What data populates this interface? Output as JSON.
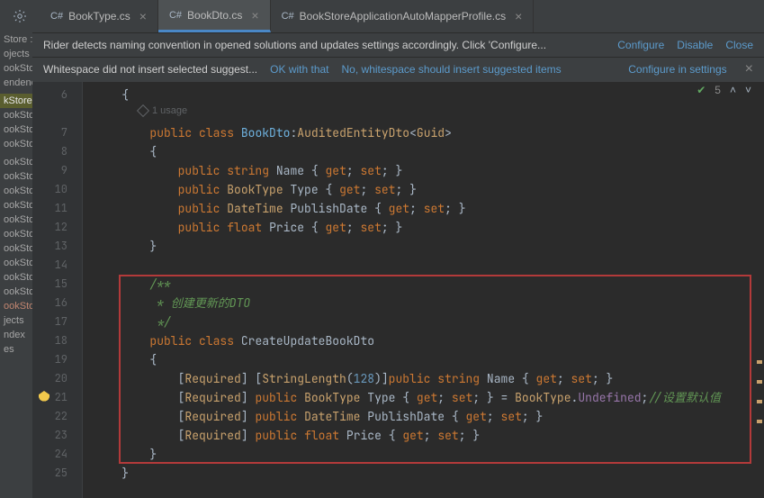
{
  "tabs": [
    {
      "label": "BookType.cs",
      "active": false
    },
    {
      "label": "BookDto.cs",
      "active": true
    },
    {
      "label": "BookStoreApplicationAutoMapperProfile.cs",
      "active": false
    }
  ],
  "banner1": {
    "msg": "Rider detects naming convention in opened solutions and updates settings accordingly. Click 'Configure...",
    "actions": {
      "configure": "Configure",
      "disable": "Disable",
      "close": "Close"
    }
  },
  "banner2": {
    "msg": "Whitespace did not insert selected suggest...",
    "actions": {
      "ok": "OK with that",
      "no": "No, whitespace should insert suggested items",
      "cfg": "Configure in settings"
    }
  },
  "leftstrip": {
    "rows": [
      "Store  : T",
      "ojects",
      "ookSto",
      "endenc",
      "",
      "kStore",
      "ookStore",
      "ookStore",
      "ookStore",
      "",
      "ookSto",
      "ookSto",
      "ookSto",
      "ookSto",
      "ookSto",
      "ookSto",
      "ookSto",
      "ookSto",
      "ookSto",
      "ookSto",
      "ookSto",
      "jects",
      "ndex",
      "es"
    ],
    "highlightIndex": 5,
    "errIndex": 20
  },
  "status": {
    "count": "5"
  },
  "code": {
    "usage": "1 usage",
    "lines": {
      "6": "    {",
      "7": {
        "t": "        ",
        "segs": [
          {
            "c": "kw",
            "t": "public"
          },
          {
            "c": "punc",
            "t": " "
          },
          {
            "c": "kw",
            "t": "class"
          },
          {
            "c": "punc",
            "t": " "
          },
          {
            "c": "ident",
            "t": "BookDto"
          },
          {
            "c": "punc",
            "t": ":"
          },
          {
            "c": "type",
            "t": "AuditedEntityDto"
          },
          {
            "c": "punc",
            "t": "<"
          },
          {
            "c": "type",
            "t": "Guid"
          },
          {
            "c": "punc",
            "t": ">"
          }
        ]
      },
      "8": "        {",
      "9": {
        "t": "            ",
        "segs": [
          {
            "c": "kw",
            "t": "public"
          },
          {
            "c": "punc",
            "t": " "
          },
          {
            "c": "kw",
            "t": "string"
          },
          {
            "c": "punc",
            "t": " "
          },
          {
            "c": "method",
            "t": "Name"
          },
          {
            "c": "punc",
            "t": " { "
          },
          {
            "c": "kw",
            "t": "get"
          },
          {
            "c": "punc",
            "t": "; "
          },
          {
            "c": "kw",
            "t": "set"
          },
          {
            "c": "punc",
            "t": "; }"
          }
        ]
      },
      "10": {
        "t": "            ",
        "segs": [
          {
            "c": "kw",
            "t": "public"
          },
          {
            "c": "punc",
            "t": " "
          },
          {
            "c": "type",
            "t": "BookType"
          },
          {
            "c": "punc",
            "t": " "
          },
          {
            "c": "method",
            "t": "Type"
          },
          {
            "c": "punc",
            "t": " { "
          },
          {
            "c": "kw",
            "t": "get"
          },
          {
            "c": "punc",
            "t": "; "
          },
          {
            "c": "kw",
            "t": "set"
          },
          {
            "c": "punc",
            "t": "; }"
          }
        ]
      },
      "11": {
        "t": "            ",
        "segs": [
          {
            "c": "kw",
            "t": "public"
          },
          {
            "c": "punc",
            "t": " "
          },
          {
            "c": "type",
            "t": "DateTime"
          },
          {
            "c": "punc",
            "t": " "
          },
          {
            "c": "method",
            "t": "PublishDate"
          },
          {
            "c": "punc",
            "t": " { "
          },
          {
            "c": "kw",
            "t": "get"
          },
          {
            "c": "punc",
            "t": "; "
          },
          {
            "c": "kw",
            "t": "set"
          },
          {
            "c": "punc",
            "t": "; }"
          }
        ]
      },
      "12": {
        "t": "            ",
        "segs": [
          {
            "c": "kw",
            "t": "public"
          },
          {
            "c": "punc",
            "t": " "
          },
          {
            "c": "kw",
            "t": "float"
          },
          {
            "c": "punc",
            "t": " "
          },
          {
            "c": "method",
            "t": "Price"
          },
          {
            "c": "punc",
            "t": " { "
          },
          {
            "c": "kw",
            "t": "get"
          },
          {
            "c": "punc",
            "t": "; "
          },
          {
            "c": "kw",
            "t": "set"
          },
          {
            "c": "punc",
            "t": "; }"
          }
        ]
      },
      "13": "        }",
      "14": "",
      "15": {
        "t": "        ",
        "segs": [
          {
            "c": "comment",
            "t": "/**"
          }
        ]
      },
      "16": {
        "t": "        ",
        "segs": [
          {
            "c": "comment",
            "t": " * 创建更新的DTO"
          }
        ]
      },
      "17": {
        "t": "        ",
        "segs": [
          {
            "c": "comment",
            "t": " */"
          }
        ]
      },
      "18": {
        "t": "        ",
        "segs": [
          {
            "c": "kw",
            "t": "public"
          },
          {
            "c": "punc",
            "t": " "
          },
          {
            "c": "kw",
            "t": "class"
          },
          {
            "c": "punc",
            "t": " "
          },
          {
            "c": "method",
            "t": "CreateUpdateBookDto"
          }
        ]
      },
      "19": "        {",
      "20": {
        "t": "            ",
        "segs": [
          {
            "c": "punc",
            "t": "["
          },
          {
            "c": "annot",
            "t": "Required"
          },
          {
            "c": "punc",
            "t": "] ["
          },
          {
            "c": "annot",
            "t": "StringLength"
          },
          {
            "c": "punc",
            "t": "("
          },
          {
            "c": "num",
            "t": "128"
          },
          {
            "c": "punc",
            "t": ")]"
          },
          {
            "c": "kw",
            "t": "public"
          },
          {
            "c": "punc",
            "t": " "
          },
          {
            "c": "kw",
            "t": "string"
          },
          {
            "c": "punc",
            "t": " "
          },
          {
            "c": "method",
            "t": "Name"
          },
          {
            "c": "punc",
            "t": " { "
          },
          {
            "c": "kw",
            "t": "get"
          },
          {
            "c": "punc",
            "t": "; "
          },
          {
            "c": "kw",
            "t": "set"
          },
          {
            "c": "punc",
            "t": "; }"
          }
        ]
      },
      "21": {
        "t": "            ",
        "segs": [
          {
            "c": "punc",
            "t": "["
          },
          {
            "c": "annot",
            "t": "Required"
          },
          {
            "c": "punc",
            "t": "] "
          },
          {
            "c": "kw",
            "t": "public"
          },
          {
            "c": "punc",
            "t": " "
          },
          {
            "c": "type",
            "t": "BookType"
          },
          {
            "c": "punc",
            "t": " "
          },
          {
            "c": "method",
            "t": "Type"
          },
          {
            "c": "punc",
            "t": " { "
          },
          {
            "c": "kw",
            "t": "get"
          },
          {
            "c": "punc",
            "t": "; "
          },
          {
            "c": "kw",
            "t": "set"
          },
          {
            "c": "punc",
            "t": "; } = "
          },
          {
            "c": "type",
            "t": "BookType"
          },
          {
            "c": "punc",
            "t": "."
          },
          {
            "c": "prop",
            "t": "Undefined"
          },
          {
            "c": "punc",
            "t": ";"
          },
          {
            "c": "comment",
            "t": "//设置默认值"
          }
        ]
      },
      "22": {
        "t": "            ",
        "segs": [
          {
            "c": "punc",
            "t": "["
          },
          {
            "c": "annot",
            "t": "Required"
          },
          {
            "c": "punc",
            "t": "] "
          },
          {
            "c": "kw",
            "t": "public"
          },
          {
            "c": "punc",
            "t": " "
          },
          {
            "c": "type",
            "t": "DateTime"
          },
          {
            "c": "punc",
            "t": " "
          },
          {
            "c": "method",
            "t": "PublishDate"
          },
          {
            "c": "punc",
            "t": " { "
          },
          {
            "c": "kw",
            "t": "get"
          },
          {
            "c": "punc",
            "t": "; "
          },
          {
            "c": "kw",
            "t": "set"
          },
          {
            "c": "punc",
            "t": "; }"
          }
        ]
      },
      "23": {
        "t": "            ",
        "segs": [
          {
            "c": "punc",
            "t": "["
          },
          {
            "c": "annot",
            "t": "Required"
          },
          {
            "c": "punc",
            "t": "] "
          },
          {
            "c": "kw",
            "t": "public"
          },
          {
            "c": "punc",
            "t": " "
          },
          {
            "c": "kw",
            "t": "float"
          },
          {
            "c": "punc",
            "t": " "
          },
          {
            "c": "method",
            "t": "Price"
          },
          {
            "c": "punc",
            "t": " { "
          },
          {
            "c": "kw",
            "t": "get"
          },
          {
            "c": "punc",
            "t": "; "
          },
          {
            "c": "kw",
            "t": "set"
          },
          {
            "c": "punc",
            "t": "; }"
          }
        ]
      },
      "24": "        }",
      "25": "    }"
    },
    "highlightBox": {
      "startLine": 15,
      "endLine": 24
    },
    "lineStart": 6,
    "lineEnd": 25
  }
}
